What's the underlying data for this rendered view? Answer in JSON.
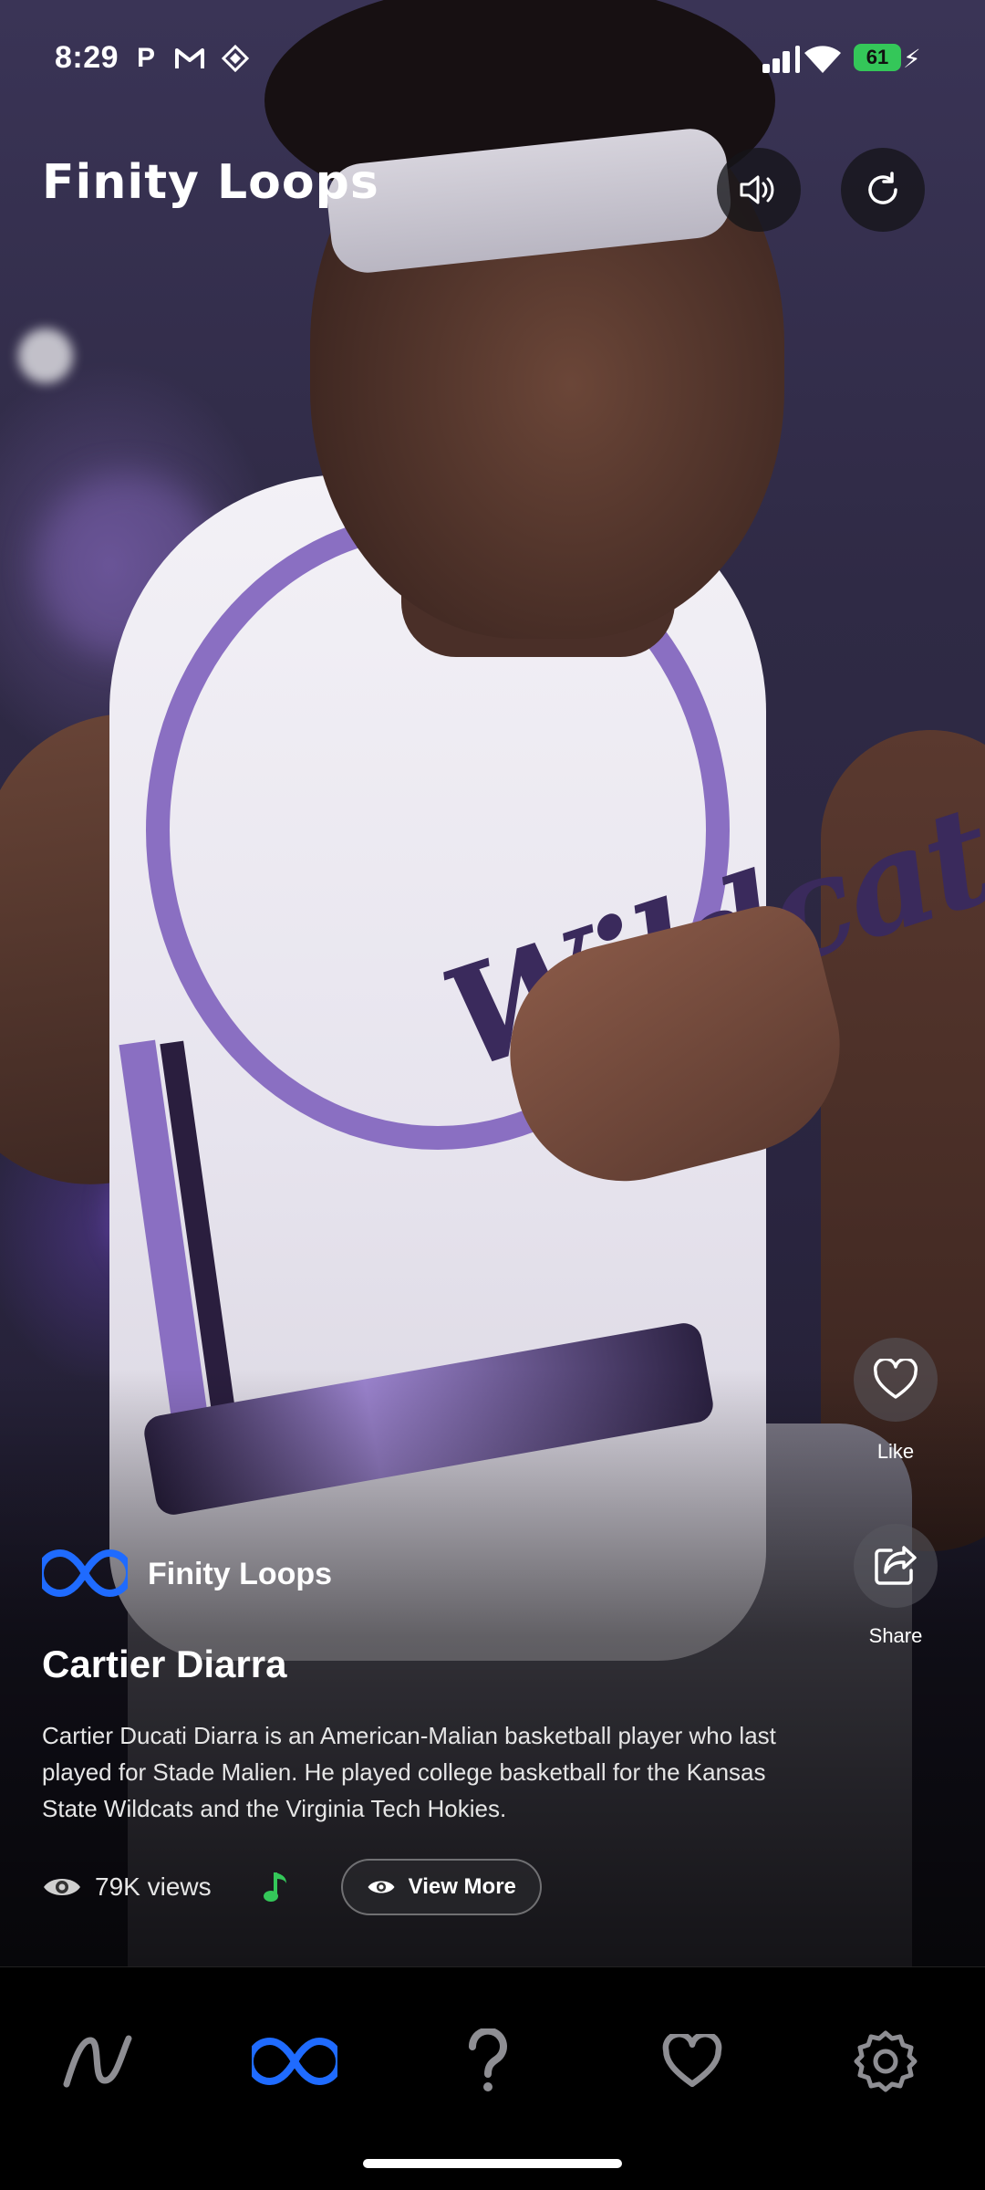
{
  "status_bar": {
    "time": "8:29",
    "battery": "61"
  },
  "header": {
    "app_logo": "Finity Loops",
    "sound_icon": "speaker-icon",
    "refresh_icon": "refresh-icon"
  },
  "actions": {
    "like_label": "Like",
    "share_label": "Share"
  },
  "post": {
    "channel_name": "Finity Loops",
    "title": "Cartier Diarra",
    "description": "Cartier Ducati Diarra is an American-Malian basketball player who last played for Stade Malien. He played college basketball for the Kansas State Wildcats and the Virginia Tech Hokies.",
    "views": "79K views",
    "view_more_label": "View More"
  },
  "nav": {
    "items": [
      {
        "icon": "trend-icon",
        "active": false
      },
      {
        "icon": "infinity-icon",
        "active": true
      },
      {
        "icon": "question-icon",
        "active": false
      },
      {
        "icon": "heart-icon",
        "active": false
      },
      {
        "icon": "settings-icon",
        "active": false
      }
    ]
  },
  "colors": {
    "accent_blue": "#1f6bff",
    "music_green": "#34c759",
    "battery_green": "#34c759",
    "nav_icon": "#8e8e93"
  }
}
